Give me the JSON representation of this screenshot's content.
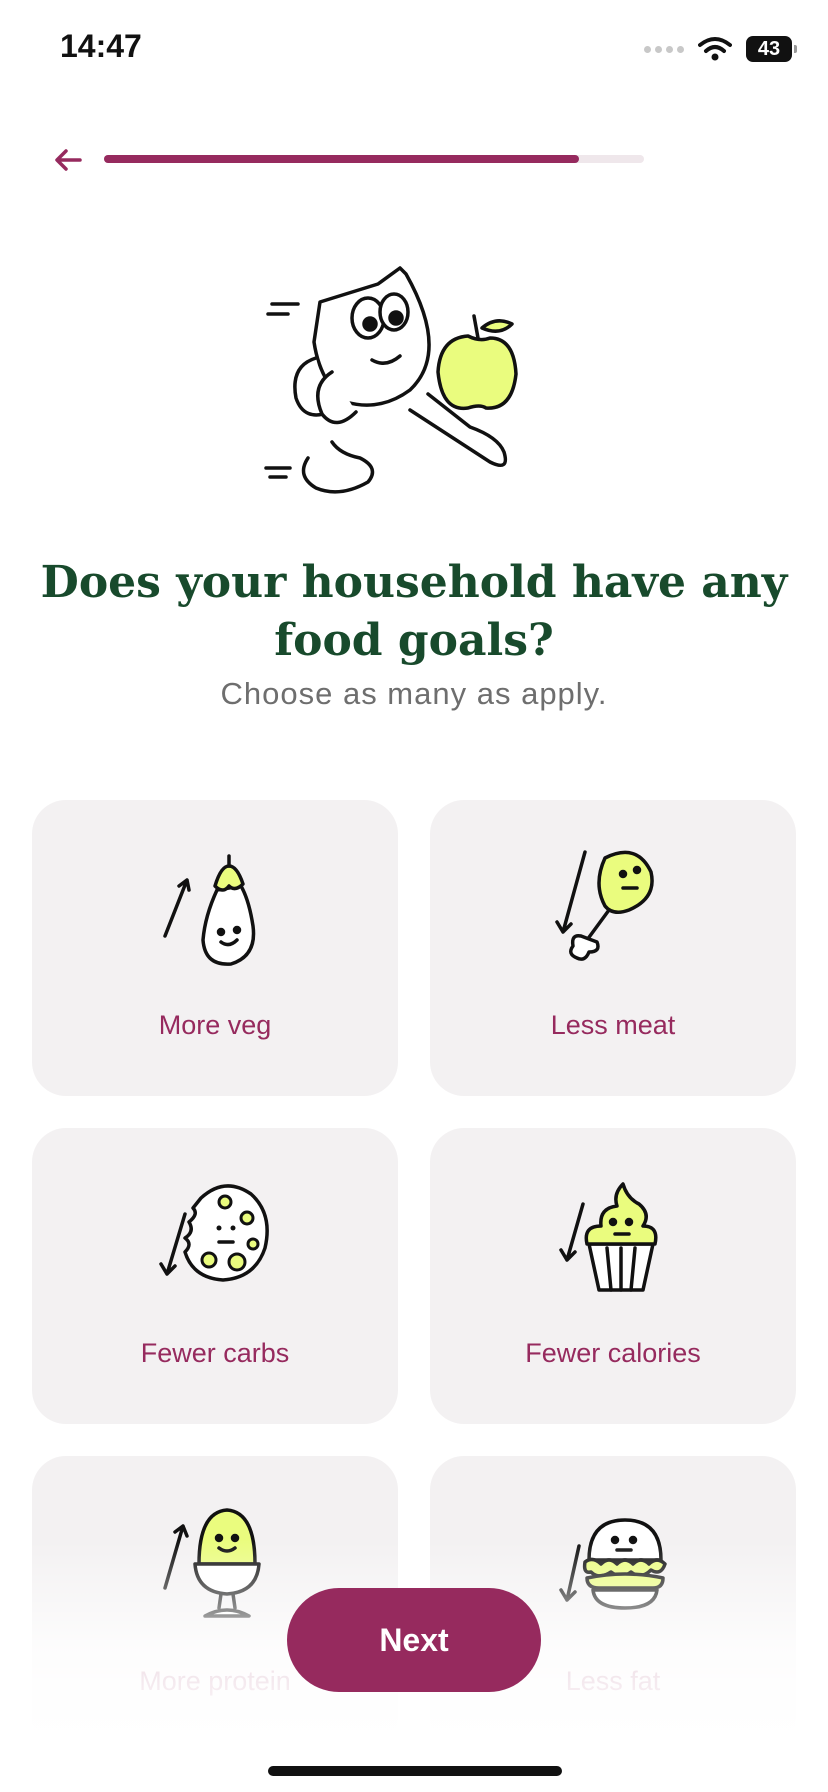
{
  "status_bar": {
    "time": "14:47",
    "battery": "43"
  },
  "progress": {
    "fraction": 0.88
  },
  "question": {
    "title": "Does your household have any food goals?",
    "subtitle": "Choose as many as apply."
  },
  "options": [
    {
      "label": "More veg",
      "icon": "eggplant-up-icon"
    },
    {
      "label": "Less meat",
      "icon": "drumstick-down-icon"
    },
    {
      "label": "Fewer carbs",
      "icon": "cookie-down-icon"
    },
    {
      "label": "Fewer calories",
      "icon": "cupcake-down-icon"
    },
    {
      "label": "More protein",
      "icon": "egg-up-icon"
    },
    {
      "label": "Less fat",
      "icon": "burger-down-icon"
    }
  ],
  "actions": {
    "next_label": "Next"
  },
  "colors": {
    "accent": "#962a5e",
    "title": "#184a2c",
    "card_bg": "#f3f1f2",
    "illustration_fill": "#eafc7e"
  }
}
